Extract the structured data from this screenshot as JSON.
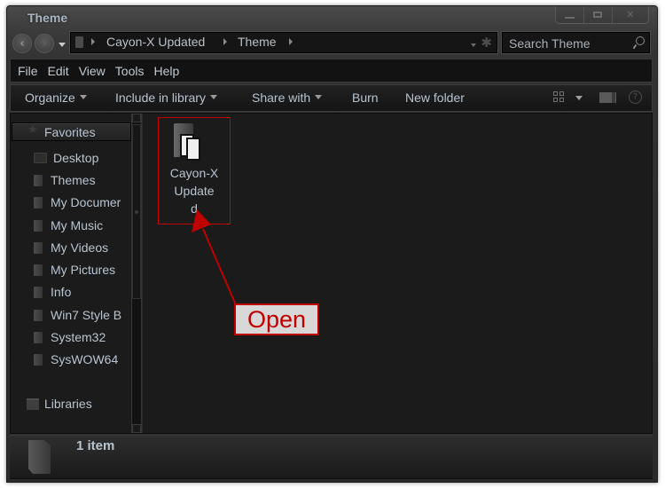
{
  "window": {
    "title": "Theme",
    "controls": {
      "minimize": "minimize",
      "maximize": "maximize",
      "close": "close",
      "close_glyph": "✕"
    }
  },
  "navigation": {
    "back_glyph": "‹",
    "forward_glyph": "›",
    "breadcrumb": [
      "Cayon-X Updated",
      "Theme"
    ],
    "search_placeholder": "Search Theme"
  },
  "menu": [
    "File",
    "Edit",
    "View",
    "Tools",
    "Help"
  ],
  "toolbar": {
    "organize": "Organize",
    "include_in_library": "Include in library",
    "share_with": "Share with",
    "burn": "Burn",
    "new_folder": "New folder",
    "help_glyph": "?"
  },
  "sidebar": {
    "favorites_label": "Favorites",
    "star_glyph": "★",
    "items": [
      {
        "label": "Desktop",
        "icon": "desktop-icon"
      },
      {
        "label": "Themes",
        "icon": "folder-icon"
      },
      {
        "label": "My Documer",
        "icon": "documents-icon"
      },
      {
        "label": "My Music",
        "icon": "music-icon"
      },
      {
        "label": "My Videos",
        "icon": "videos-icon"
      },
      {
        "label": "My Pictures",
        "icon": "pictures-icon"
      },
      {
        "label": "Info",
        "icon": "folder-icon"
      },
      {
        "label": "Win7 Style B",
        "icon": "folder-icon"
      },
      {
        "label": "System32",
        "icon": "folder-icon"
      },
      {
        "label": "SysWOW64",
        "icon": "folder-icon"
      }
    ],
    "libraries_label": "Libraries"
  },
  "content": {
    "items": [
      {
        "name": "Cayon-X Update d",
        "name_lines": [
          "Cayon-X",
          "Update",
          "d"
        ],
        "type": "folder"
      }
    ]
  },
  "status": {
    "item_count": "1 item"
  },
  "annotation": {
    "label": "Open",
    "color": "#c00000"
  }
}
